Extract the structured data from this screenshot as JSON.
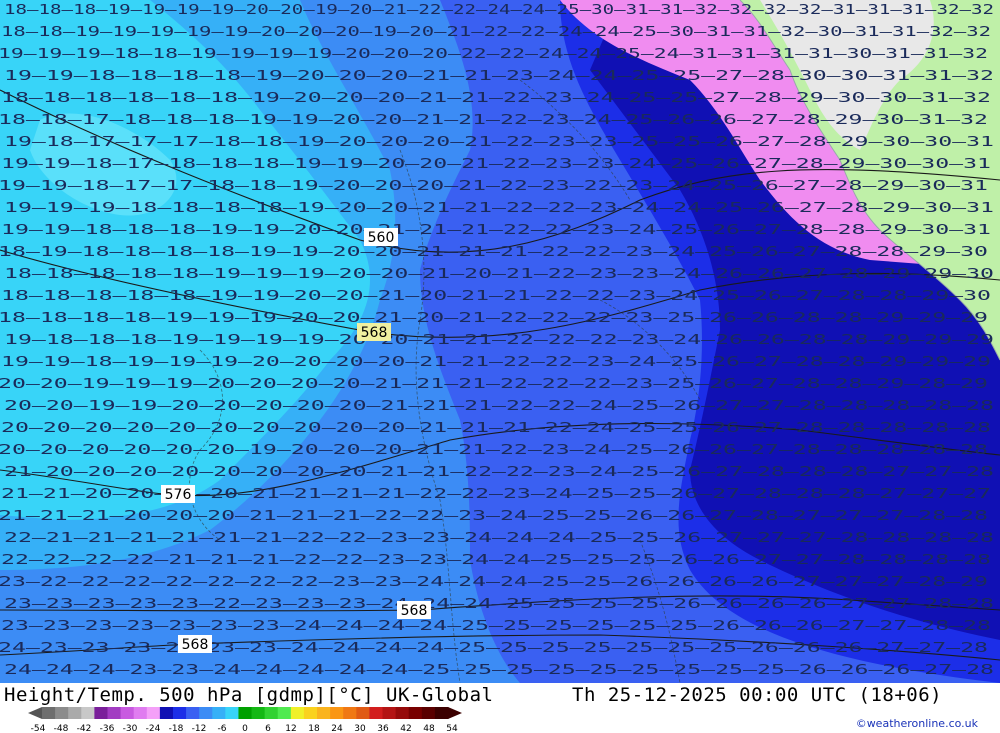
{
  "title": {
    "left": "Height/Temp. 500 hPa [gdmp][°C] UK-Global",
    "right": "Th 25-12-2025 00:00 UTC (18+06)"
  },
  "credit": "©weatheronline.co.uk",
  "legend": {
    "ticks": [
      "-54",
      "-48",
      "-42",
      "-36",
      "-30",
      "-24",
      "-18",
      "-12",
      "-6",
      "0",
      "6",
      "12",
      "18",
      "24",
      "30",
      "36",
      "42",
      "48",
      "54"
    ],
    "colors": [
      "#6e6e6e",
      "#8c8c8c",
      "#aaaaaa",
      "#c8c8c8",
      "#7a1f9a",
      "#a23cc2",
      "#c85ae0",
      "#e07cf0",
      "#f4a0f8",
      "#1010b4",
      "#1c2ee8",
      "#3a60f2",
      "#3c8cf5",
      "#36b0f7",
      "#38d4f8",
      "#00a000",
      "#14b814",
      "#32d232",
      "#50ea50",
      "#f0f028",
      "#fad21e",
      "#fab41e",
      "#fa9614",
      "#f07814",
      "#e05a14",
      "#d21e1e",
      "#b41414",
      "#960a0a",
      "#780000",
      "#5a0000",
      "#3c0000"
    ]
  },
  "map": {
    "colors": {
      "cyan": "#38d4f8",
      "lightblue": "#36b0f7",
      "blue": "#3c8cf5",
      "midblue": "#3a60f2",
      "darkblue": "#1c2ee8",
      "navy": "#1010b4",
      "pink": "#f08cf0",
      "land": "#bff0a8",
      "lake": "#e8e8e8"
    },
    "height_labels": [
      "560",
      "568",
      "576",
      "568",
      "568"
    ],
    "temp_rows": [
      "18 18 18 19 19 19 19 20 20 19 20 21 22 22 24 24 25 30 31 31 32 32 32 32 31 31 31 32 32",
      "18 18 19 19 19 19 19 20 20 20 19 20 21 22 22 24 24 25 30 31 31 32 30 31 31 32 32",
      "19 19 19 18 18 19 19 19 19 20 20 20 22 22 24 24 25 24 31 31 31 31 30 31 31 32",
      "19 19 18 18 18 18 19 20 20 20 21 21 23 24 24 25 25 27 28 30 30 31 31 32",
      "18 18 18 18 18 18 19 20 20 20 21 21 22 23 24 25 25 27 28 29 30 30 31 32",
      "18 18 17 18 18 18 19 19 20 20 21 21 22 23 24 25 26 26 27 28 29 30 31 32",
      "19 18 17 17 17 18 18 19 20 20 20 21 22 23 23 25 25 26 27 28 29 30 30 31",
      "19 19 18 17 18 18 18 19 19 20 20 21 22 23 23 24 25 26 27 28 29 30 30 31",
      "19 19 18 17 17 18 18 19 20 20 20 21 22 23 22 23 24 25 26 27 28 29 30 31",
      "19 19 19 18 18 18 18 19 20 20 21 21 22 22 23 24 24 25 26 27 28 29 30 31",
      "19 19 18 18 18 19 19 20 20 21 21 21 22 22 23 24 25 26 27 28 28 29 30 31",
      "18 19 18 18 18 18 19 19 20 20 21 21 21 22 22 23 24 25 26 27 28 28 29 30",
      "18 18 18 18 18 19 19 19 20 20 21 20 21 22 23 23 24 26 26 27 28 29 29 30",
      "18 18 18 18 18 19 19 20 20 21 20 21 21 22 22 23 24 25 26 27 28 28 29 30",
      "18 18 18 18 19 19 19 20 20 21 20 21 22 22 22 23 25 26 26 28 28 29 29 29",
      "19 18 18 18 19 19 19 19 20 20 21 21 22 22 22 23 24 26 26 28 28 29 29 29",
      "19 19 18 19 19 19 20 20 20 20 21 21 22 22 23 24 25 26 27 28 28 29 29 29",
      "20 20 19 19 19 20 20 20 20 21 21 21 22 22 22 23 25 26 27 28 28 29 28 29",
      "20 20 19 19 20 20 20 20 20 21 21 21 22 22 24 25 26 27 27 28 28 28 28 28",
      "20 20 20 20 20 20 20 20 20 20 21 21 21 22 24 25 25 26 27 28 28 28 28 28",
      "20 20 20 20 20 20 19 20 20 20 21 21 22 23 24 25 26 26 27 28 28 28 28 28",
      "21 20 20 20 20 20 20 20 20 21 21 22 22 23 24 25 26 27 28 28 28 27 27 28",
      "21 21 20 20 20 20 21 21 21 21 22 22 23 24 25 25 26 27 28 28 28 27 27 27",
      "21 21 21 20 20 20 21 21 21 22 22 23 24 25 25 26 26 27 28 27 27 27 28 28",
      "22 21 21 21 21 21 21 22 22 23 23 24 24 24 25 25 26 27 27 27 28 28 28 28",
      "22 22 22 22 21 21 21 22 22 23 23 24 24 25 25 25 26 26 27 27 28 28 28 28",
      "23 22 22 22 22 22 22 22 23 23 24 24 24 25 25 26 26 26 26 27 27 27 28 29",
      "23 23 23 23 23 22 23 23 23 24 24 24 25 25 25 25 26 26 26 26 27 27 28 28",
      "23 23 23 23 23 23 23 24 24 24 24 25 25 25 25 25 25 26 26 26 27 27 28 28",
      "24 23 23 23 23 23 23 24 24 24 24 25 25 25 25 25 25 25 26 26 26 27 27 28",
      "24 24 24 23 23 24 24 24 24 24 25 25 25 25 25 25 25 25 25 26 26 26 27 28"
    ]
  }
}
